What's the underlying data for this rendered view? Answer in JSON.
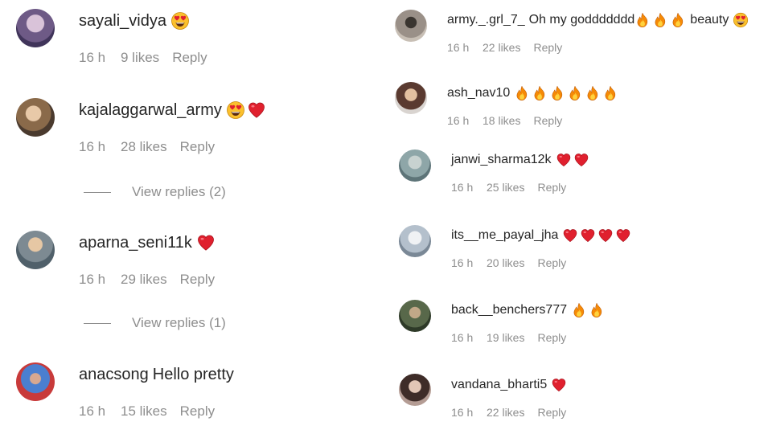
{
  "left_comments": [
    {
      "username": "sayali_vidya",
      "text": "",
      "emojis": [
        "heart-eyes"
      ],
      "age": "16 h",
      "likes": "9 likes",
      "reply": "Reply",
      "view_replies": ""
    },
    {
      "username": "kajalaggarwal_army",
      "text": "",
      "emojis": [
        "heart-eyes",
        "red-heart"
      ],
      "age": "16 h",
      "likes": "28 likes",
      "reply": "Reply",
      "view_replies": "View replies (2)"
    },
    {
      "username": "aparna_seni11k",
      "text": "",
      "emojis": [
        "red-heart"
      ],
      "age": "16 h",
      "likes": "29 likes",
      "reply": "Reply",
      "view_replies": "View replies (1)"
    },
    {
      "username": "anacsong",
      "text": "Hello pretty",
      "emojis": [],
      "age": "16 h",
      "likes": "15 likes",
      "reply": "Reply",
      "view_replies": ""
    }
  ],
  "right_comments": [
    {
      "username": "army._.grl_7_",
      "text": "Oh my goddddddd",
      "emojis": [
        "fire",
        "fire",
        "fire"
      ],
      "text_after": "beauty",
      "emojis_after": [
        "heart-eyes"
      ],
      "age": "16 h",
      "likes": "22 likes",
      "reply": "Reply"
    },
    {
      "username": "ash_nav10",
      "text": "",
      "emojis": [
        "fire",
        "fire",
        "fire",
        "fire",
        "fire",
        "fire"
      ],
      "age": "16 h",
      "likes": "18 likes",
      "reply": "Reply"
    },
    {
      "username": "janwi_sharma12k",
      "text": "",
      "emojis": [
        "red-heart",
        "red-heart"
      ],
      "age": "16 h",
      "likes": "25 likes",
      "reply": "Reply"
    },
    {
      "username": "its__me_payal_jha",
      "text": "",
      "emojis": [
        "red-heart",
        "red-heart",
        "red-heart",
        "red-heart"
      ],
      "age": "16 h",
      "likes": "20 likes",
      "reply": "Reply"
    },
    {
      "username": "back__benchers777",
      "text": "",
      "emojis": [
        "fire",
        "fire"
      ],
      "age": "16 h",
      "likes": "19 likes",
      "reply": "Reply"
    },
    {
      "username": "vandana_bharti5",
      "text": "",
      "emojis": [
        "red-heart"
      ],
      "age": "16 h",
      "likes": "22 likes",
      "reply": "Reply"
    }
  ],
  "colors": {
    "text": "#262626",
    "meta": "#8e8e8e",
    "heart": "#e0202e",
    "fire": "#f58a07",
    "emoji_face": "#fbc02d"
  }
}
